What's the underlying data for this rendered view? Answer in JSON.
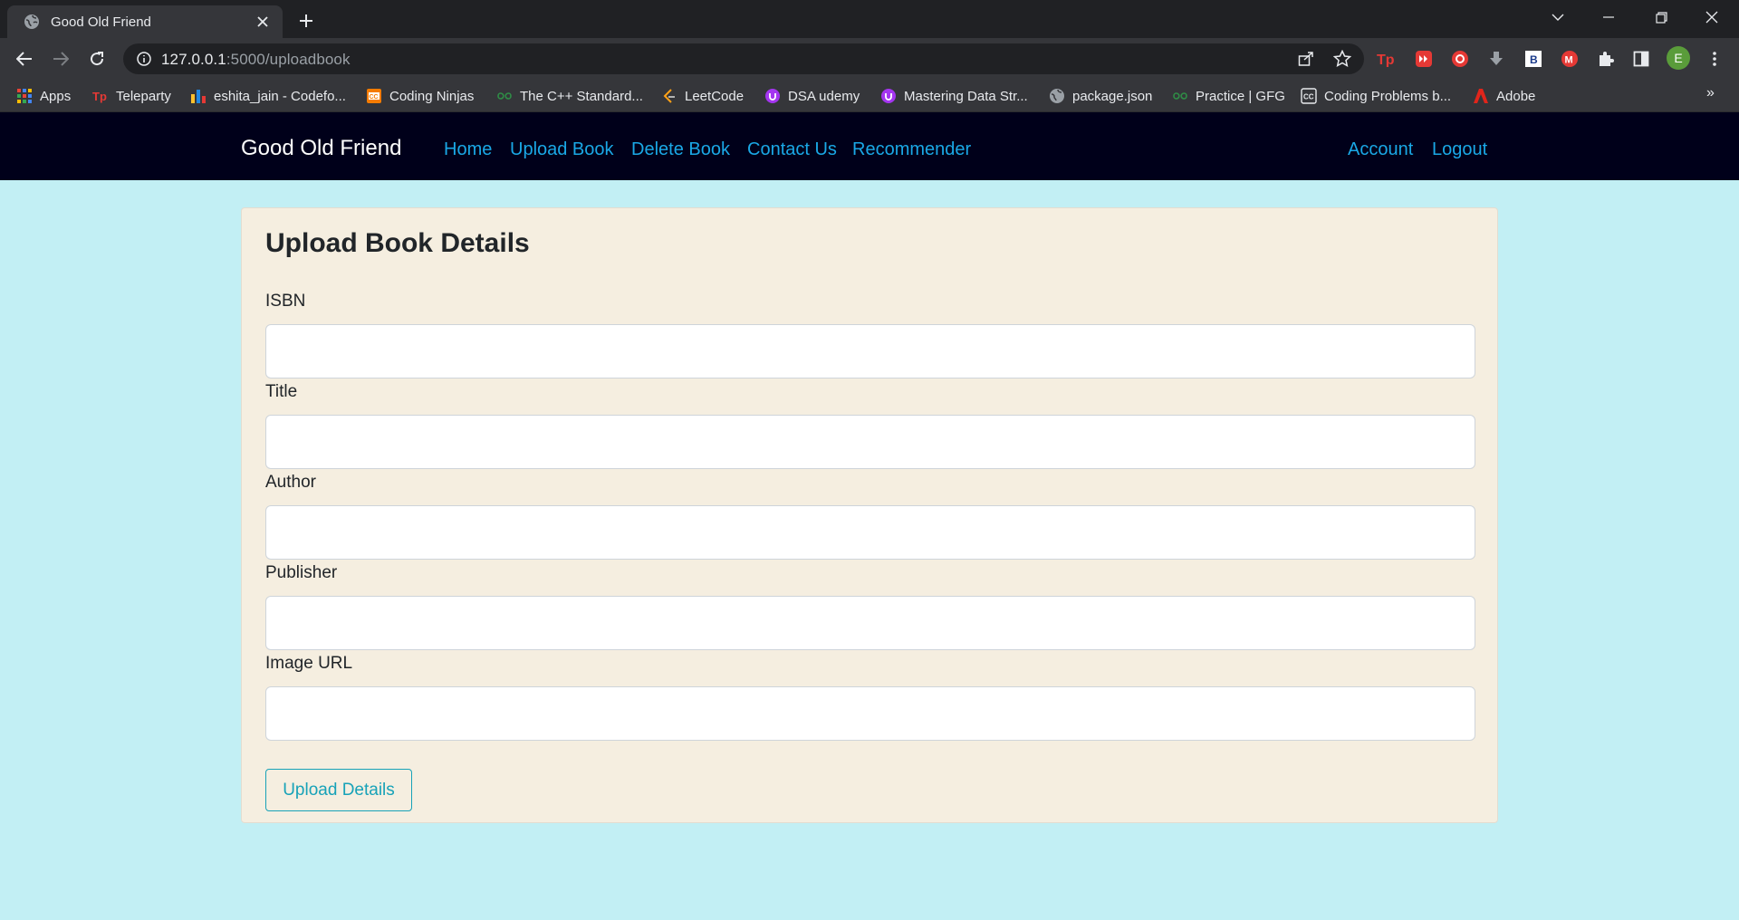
{
  "browser": {
    "tab_title": "Good Old Friend",
    "url_host": "127.0.0.1",
    "url_path": ":5000/uploadbook",
    "avatar_letter": "E",
    "bookmarks": [
      {
        "label": "Apps",
        "icon": "apps-grid-icon"
      },
      {
        "label": "Teleparty",
        "icon": "teleparty-icon"
      },
      {
        "label": "eshita_jain - Codefo...",
        "icon": "codeforces-icon"
      },
      {
        "label": "Coding Ninjas",
        "icon": "coding-ninjas-icon"
      },
      {
        "label": "The C++ Standard...",
        "icon": "gfg-icon"
      },
      {
        "label": "LeetCode",
        "icon": "leetcode-icon"
      },
      {
        "label": "DSA udemy",
        "icon": "udemy-icon"
      },
      {
        "label": "Mastering Data Str...",
        "icon": "udemy-icon"
      },
      {
        "label": "package.json",
        "icon": "globe-icon"
      },
      {
        "label": "Practice | GFG",
        "icon": "gfg-icon"
      },
      {
        "label": "Coding Problems b...",
        "icon": "codechef-icon"
      },
      {
        "label": "Adobe",
        "icon": "adobe-icon"
      }
    ],
    "more_bookmarks": "»"
  },
  "site": {
    "brand": "Good Old Friend",
    "nav_links": [
      "Home",
      "Upload Book",
      "Delete Book",
      "Contact Us",
      "Recommender"
    ],
    "account": "Account",
    "logout": "Logout",
    "link_color": "#1aa8e6",
    "nav_bg": "#00001a"
  },
  "form": {
    "title": "Upload Book Details",
    "fields": [
      {
        "label": "ISBN",
        "value": ""
      },
      {
        "label": "Title",
        "value": ""
      },
      {
        "label": "Author",
        "value": ""
      },
      {
        "label": "Publisher",
        "value": ""
      },
      {
        "label": "Image URL",
        "value": ""
      }
    ],
    "submit_label": "Upload Details",
    "accent": "#17a2b8"
  },
  "colors": {
    "page_bg": "#c2eff4",
    "card_bg": "#f5eee0"
  }
}
